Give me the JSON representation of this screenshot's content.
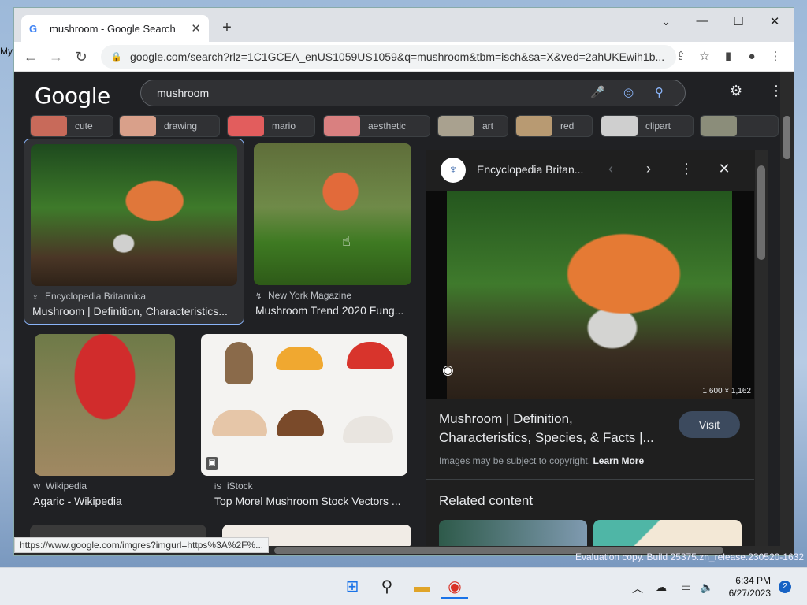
{
  "desktop": {
    "fragment": "My"
  },
  "browser": {
    "tab_title": "mushroom - Google Search",
    "new_tab": "+",
    "url": "google.com/search?rlz=1C1GCEA_enUS1059US1059&q=mushroom&tbm=isch&sa=X&ved=2ahUKEwih1b..."
  },
  "google": {
    "logo": "Google",
    "query": "mushroom",
    "chips": [
      {
        "label": "cute",
        "color": "#c86a5a"
      },
      {
        "label": "drawing",
        "color": "#d9a08a"
      },
      {
        "label": "mario",
        "color": "#e25d5d"
      },
      {
        "label": "aesthetic",
        "color": "#d98080"
      },
      {
        "label": "art",
        "color": "#a9a18f"
      },
      {
        "label": "red",
        "color": "#b89a72"
      },
      {
        "label": "clipart",
        "color": "#cfcfcf"
      },
      {
        "label": "",
        "color": "#8b8d7a"
      }
    ]
  },
  "results": [
    {
      "source": "Encyclopedia Britannica",
      "title": "Mushroom | Definition, Characteristics..."
    },
    {
      "source": "New York Magazine",
      "title": "Mushroom Trend 2020 Fung..."
    },
    {
      "source": "Wikipedia",
      "title": "Agaric - Wikipedia"
    },
    {
      "source": "iStock",
      "title": "Top Morel Mushroom Stock Vectors ..."
    }
  ],
  "preview": {
    "site": "Encyclopedia Britan...",
    "dimensions": "1,600 × 1,162",
    "title": "Mushroom | Definition, Characteristics, Species, & Facts |...",
    "visit": "Visit",
    "copyright": "Images may be subject to copyright.",
    "learn_more": "Learn More",
    "related": "Related content"
  },
  "status_url": "https://www.google.com/imgres?imgurl=https%3A%2F%...",
  "eval_text": "Evaluation copy. Build 25375.zn_release.230520-1632",
  "clock": {
    "time": "6:34 PM",
    "date": "6/27/2023"
  },
  "notifications": "2"
}
